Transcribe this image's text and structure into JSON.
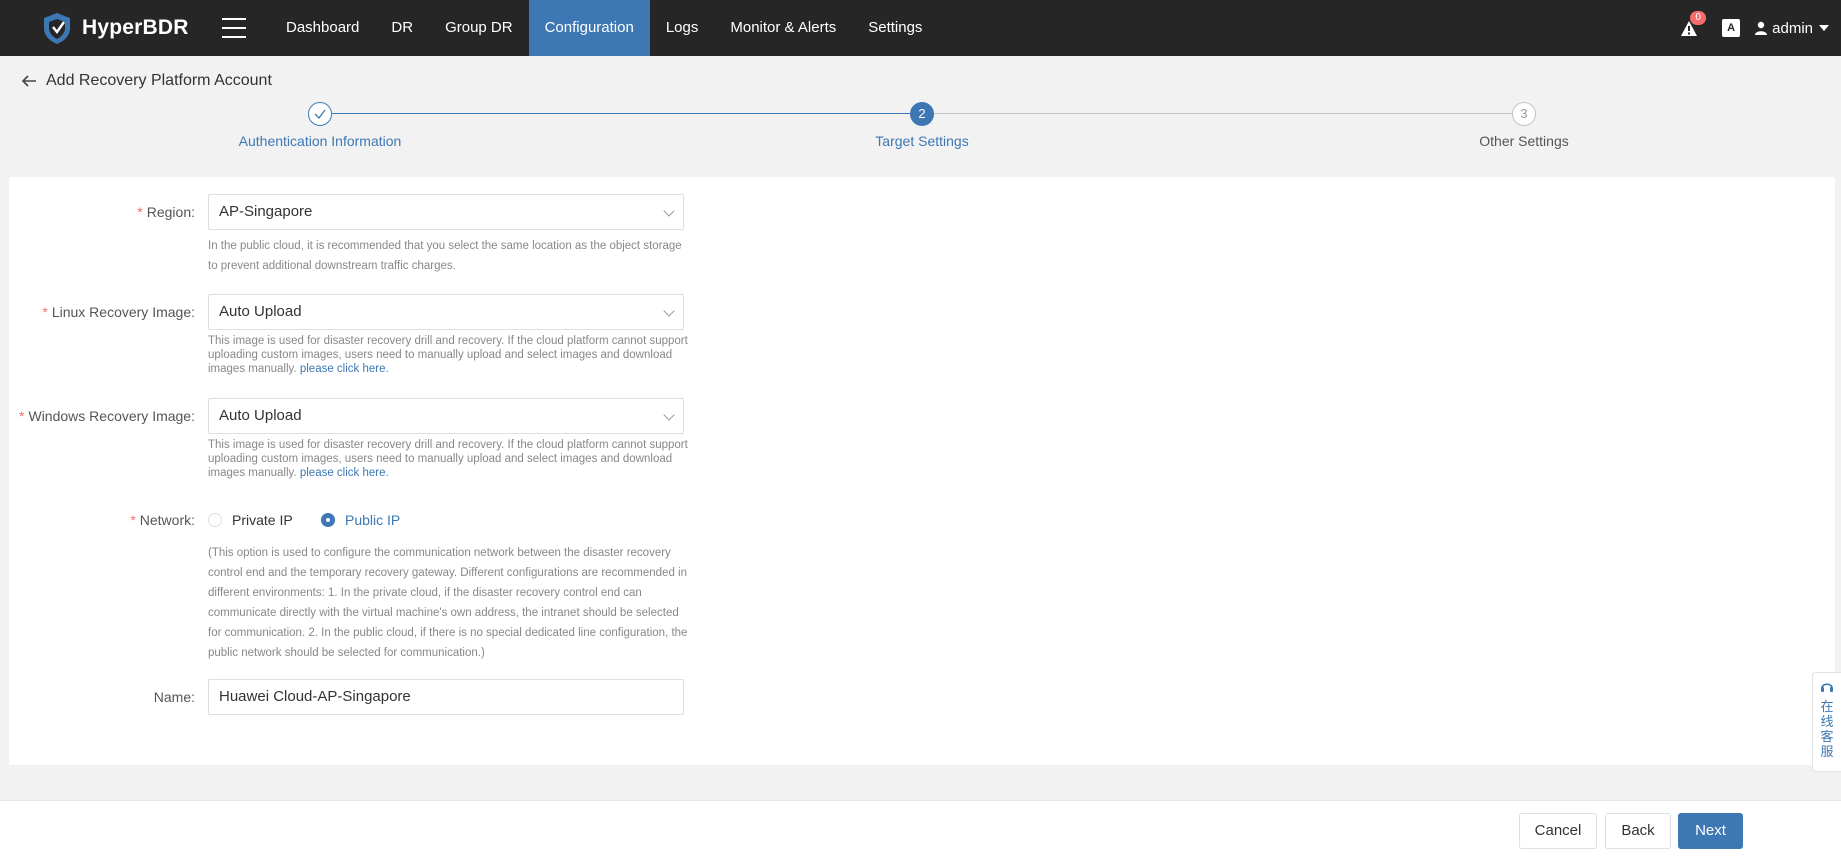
{
  "app": {
    "name": "HyperBDR"
  },
  "nav": [
    {
      "label": "Dashboard",
      "active": false
    },
    {
      "label": "DR",
      "active": false
    },
    {
      "label": "Group DR",
      "active": false
    },
    {
      "label": "Configuration",
      "active": true
    },
    {
      "label": "Logs",
      "active": false
    },
    {
      "label": "Monitor & Alerts",
      "active": false
    },
    {
      "label": "Settings",
      "active": false
    }
  ],
  "topright": {
    "alert_count": "0",
    "lang_icon": "A",
    "user": "admin"
  },
  "page": {
    "title": "Add Recovery Platform Account"
  },
  "steps": [
    {
      "label": "Authentication Information",
      "number": "",
      "state": "done"
    },
    {
      "label": "Target Settings",
      "number": "2",
      "state": "active"
    },
    {
      "label": "Other Settings",
      "number": "3",
      "state": "pending"
    }
  ],
  "form": {
    "region": {
      "label": "Region:",
      "value": "AP-Singapore",
      "help": "In the public cloud, it is recommended that you select the same location as the object storage to prevent additional downstream traffic charges."
    },
    "linux_image": {
      "label": "Linux Recovery Image:",
      "value": "Auto Upload",
      "help": "This image is used for disaster recovery drill and recovery. If the cloud platform cannot support uploading custom images, users need to manually upload and select images and download images manually.",
      "link": "please click here."
    },
    "windows_image": {
      "label": "Windows Recovery Image:",
      "value": "Auto Upload",
      "help": "This image is used for disaster recovery drill and recovery. If the cloud platform cannot support uploading custom images, users need to manually upload and select images and download images manually.",
      "link": "please click here."
    },
    "network": {
      "label": "Network:",
      "options": [
        "Private IP",
        "Public IP"
      ],
      "selected": "Public IP",
      "help": "(This option is used to configure the communication network between the disaster recovery control end and the temporary recovery gateway. Different configurations are recommended in different environments: 1. In the private cloud, if the disaster recovery control end can communicate directly with the virtual machine's own address, the intranet should be selected for communication. 2. In the public cloud, if there is no special dedicated line configuration, the public network should be selected for communication.)"
    },
    "name": {
      "label": "Name:",
      "value": "Huawei Cloud-AP-Singapore"
    }
  },
  "footer": {
    "cancel": "Cancel",
    "back": "Back",
    "next": "Next"
  },
  "chat_widget": {
    "label": "在线客服"
  },
  "colors": {
    "primary": "#3d78b4",
    "topbar": "#262626",
    "required": "#f56c6c",
    "page_bg": "#f2f2f2"
  }
}
